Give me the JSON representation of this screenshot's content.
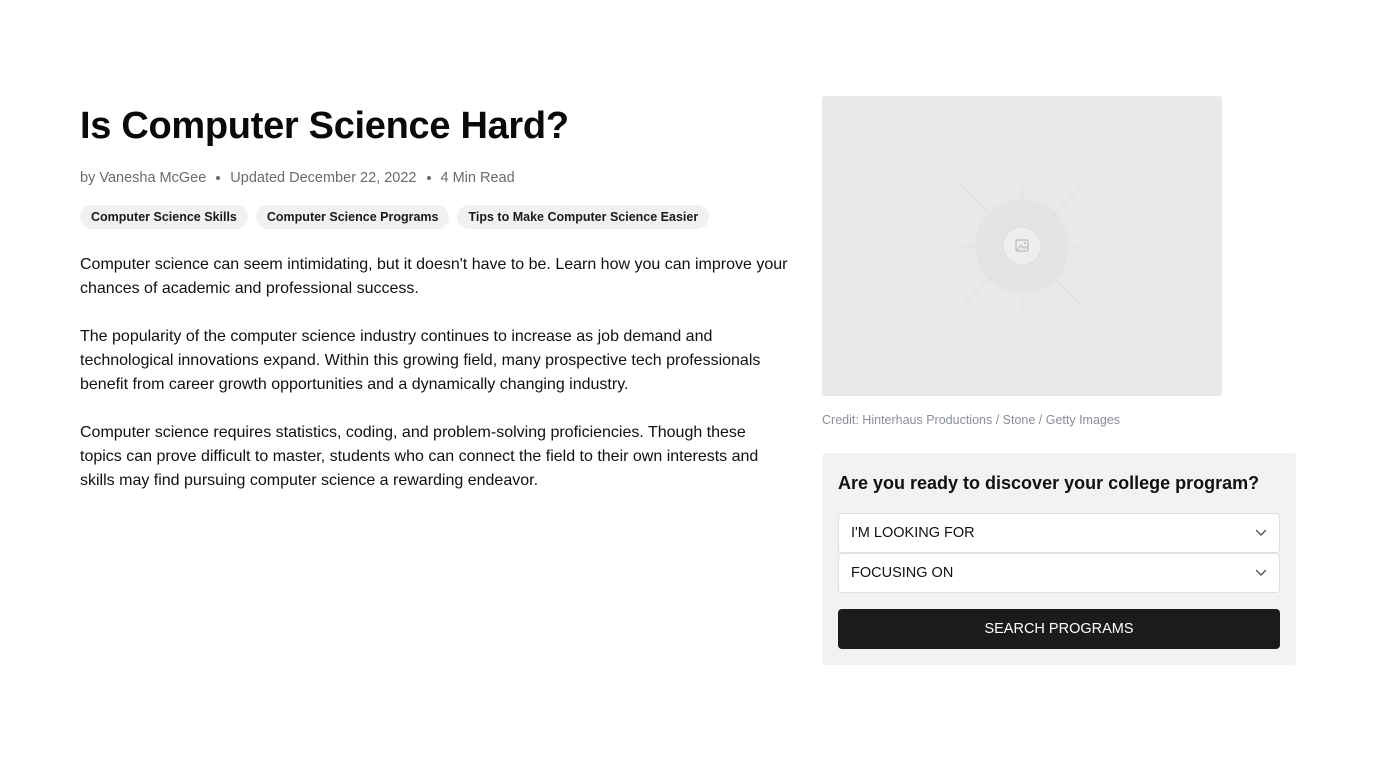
{
  "article": {
    "title": "Is Computer Science Hard?",
    "meta": {
      "author": "by Vanesha McGee",
      "updated": "Updated December 22, 2022",
      "read_time": "4 Min Read"
    },
    "tags": [
      {
        "label": "Computer Science Skills"
      },
      {
        "label": "Computer Science Programs"
      },
      {
        "label": "Tips to Make Computer Science Easier"
      }
    ],
    "paragraphs": [
      "Computer science can seem intimidating, but it doesn't have to be. Learn how you can improve your chances of academic and professional success.",
      "The popularity of the computer science industry continues to increase as job demand and technological innovations expand. Within this growing field, many prospective tech professionals benefit from career growth opportunities and a dynamically changing industry.",
      "Computer science requires statistics, coding, and problem-solving proficiencies. Though these topics can prove difficult to master, students who can connect the field to their own interests and skills may find pursuing computer science a rewarding endeavor."
    ]
  },
  "hero": {
    "icon": "image-placeholder-icon",
    "credit": "Credit: Hinterhaus Productions / Stone / Getty Images"
  },
  "finder": {
    "title": "Are you ready to discover your college program?",
    "looking_for": "I'M LOOKING FOR",
    "focusing_on": "FOCUSING ON",
    "search_label": "SEARCH PROGRAMS",
    "chevron_icon": "chevron-down-icon"
  },
  "colors": {
    "button_bg": "#1b1b1d",
    "panel_bg": "#f1f2f4",
    "tag_bg": "#f1f1f1",
    "hero_bg": "#e9e9e9"
  }
}
